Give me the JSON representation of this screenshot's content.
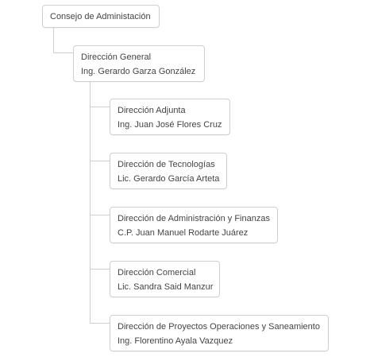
{
  "org_chart": {
    "root": {
      "label": "Consejo de Administación"
    },
    "general": {
      "title": "Dirección General",
      "person": "Ing. Gerardo Garza González"
    },
    "children": [
      {
        "title": "Dirección Adjunta",
        "person": "Ing. Juan José Flores Cruz"
      },
      {
        "title": "Dirección de Tecnologías",
        "person": "Lic. Gerardo García Arteta"
      },
      {
        "title": "Dirección de Administración y Finanzas",
        "person": "C.P. Juan Manuel Rodarte Juárez"
      },
      {
        "title": "Dirección Comercial",
        "person": "Lic. Sandra Said Manzur"
      },
      {
        "title": "Dirección de Proyectos Operaciones y Saneamiento",
        "person": "Ing. Florentino Ayala Vazquez"
      }
    ]
  },
  "colors": {
    "border": "#cfcfcf",
    "text": "#444444",
    "connector": "#cfcfcf"
  }
}
